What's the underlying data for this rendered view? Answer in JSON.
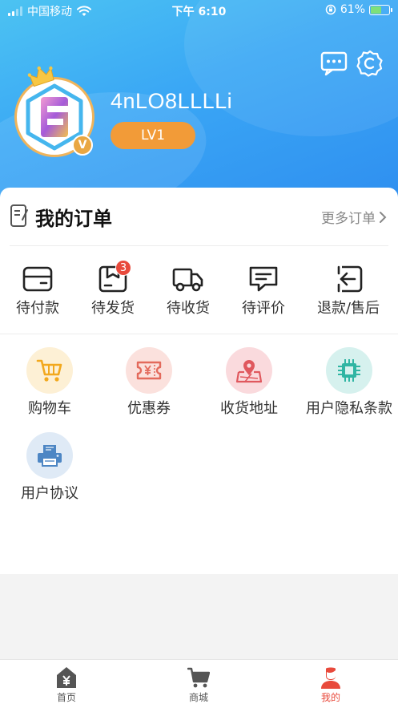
{
  "status_bar": {
    "carrier": "中国移动",
    "time": "下午 6:10",
    "battery_percent": "61%",
    "battery_level": 0.61
  },
  "profile": {
    "avatar_letter": "F",
    "vip_badge": "V",
    "username": "4nLO8LLLLi",
    "level": "LV1"
  },
  "header_icons": [
    "message-icon",
    "settings-icon"
  ],
  "orders": {
    "title": "我的订单",
    "more_label": "更多订单",
    "items": [
      {
        "label": "待付款",
        "icon": "wallet-icon"
      },
      {
        "label": "待发货",
        "icon": "package-icon",
        "badge": "3"
      },
      {
        "label": "待收货",
        "icon": "truck-icon"
      },
      {
        "label": "待评价",
        "icon": "comment-icon"
      },
      {
        "label": "退款/售后",
        "icon": "return-icon"
      }
    ]
  },
  "services": [
    {
      "label": "购物车",
      "icon": "cart-icon",
      "bg": "#fdf0d5",
      "color": "#f2a81e"
    },
    {
      "label": "优惠券",
      "icon": "coupon-icon",
      "bg": "#fbe1dd",
      "color": "#e36a5c"
    },
    {
      "label": "收货地址",
      "icon": "map-pin-icon",
      "bg": "#fadadd",
      "color": "#e0585e"
    },
    {
      "label": "用户隐私条款",
      "icon": "chip-icon",
      "bg": "#d6f1ee",
      "color": "#2fb5a3"
    },
    {
      "label": "用户协议",
      "icon": "printer-icon",
      "bg": "#dfeaf6",
      "color": "#4d86c4"
    }
  ],
  "tabbar": [
    {
      "label": "首页",
      "icon": "home-icon",
      "active": false
    },
    {
      "label": "商城",
      "icon": "cart-icon",
      "active": false
    },
    {
      "label": "我的",
      "icon": "profile-icon",
      "active": true
    }
  ],
  "colors": {
    "header_gradient": [
      "#4cc3f2",
      "#2f8ff0"
    ],
    "accent": "#e84a3c",
    "level_pill": "#f29b38"
  }
}
